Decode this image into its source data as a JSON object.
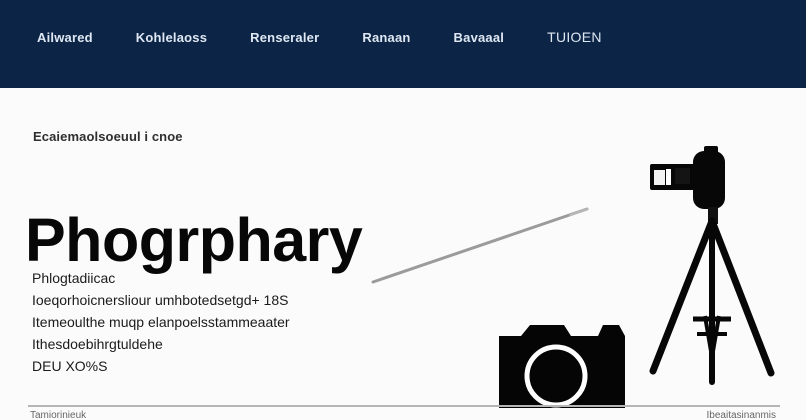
{
  "nav": {
    "items": [
      {
        "label": "Ailwared"
      },
      {
        "label": "Kohlelaoss"
      },
      {
        "label": "Renseraler"
      },
      {
        "label": "Ranaan"
      },
      {
        "label": "Bavaaal"
      },
      {
        "label": "TUIOEN"
      }
    ]
  },
  "hero": {
    "kicker": "Ecaiemaolsoeuul i cnoe",
    "title": "Phogrphary",
    "description_lines": [
      "Phlogtadiicac",
      "Ioeqorhoicnersliour umhbotedsetgd+ 18S",
      "Itemeoulthe muqp elanpoelsstammeaater",
      "Ithesdoebihrgtuldehe",
      "DEU XO%S"
    ]
  },
  "icons": {
    "tripod_camera": "camera-on-tripod-icon",
    "camera": "camera-icon",
    "pointer": "pointer-line-icon"
  },
  "footer": {
    "left": "Tamiorinieuk",
    "right": "Ibeaitasinanmis"
  },
  "colors": {
    "header": "#0c2546",
    "nav_text": "#dfe7f3",
    "text": "#111111",
    "background": "#fbfbfb",
    "line": "#9b9b9b"
  }
}
